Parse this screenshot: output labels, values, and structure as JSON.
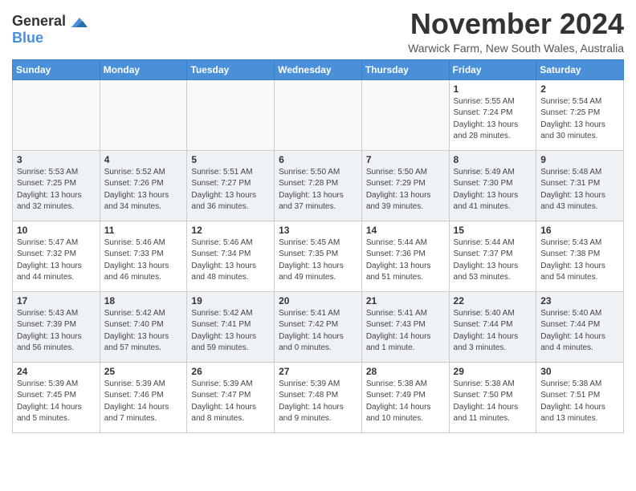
{
  "header": {
    "logo_general": "General",
    "logo_blue": "Blue",
    "month_title": "November 2024",
    "subtitle": "Warwick Farm, New South Wales, Australia"
  },
  "weekdays": [
    "Sunday",
    "Monday",
    "Tuesday",
    "Wednesday",
    "Thursday",
    "Friday",
    "Saturday"
  ],
  "weeks": [
    [
      {
        "day": "",
        "info": ""
      },
      {
        "day": "",
        "info": ""
      },
      {
        "day": "",
        "info": ""
      },
      {
        "day": "",
        "info": ""
      },
      {
        "day": "",
        "info": ""
      },
      {
        "day": "1",
        "info": "Sunrise: 5:55 AM\nSunset: 7:24 PM\nDaylight: 13 hours\nand 28 minutes."
      },
      {
        "day": "2",
        "info": "Sunrise: 5:54 AM\nSunset: 7:25 PM\nDaylight: 13 hours\nand 30 minutes."
      }
    ],
    [
      {
        "day": "3",
        "info": "Sunrise: 5:53 AM\nSunset: 7:25 PM\nDaylight: 13 hours\nand 32 minutes."
      },
      {
        "day": "4",
        "info": "Sunrise: 5:52 AM\nSunset: 7:26 PM\nDaylight: 13 hours\nand 34 minutes."
      },
      {
        "day": "5",
        "info": "Sunrise: 5:51 AM\nSunset: 7:27 PM\nDaylight: 13 hours\nand 36 minutes."
      },
      {
        "day": "6",
        "info": "Sunrise: 5:50 AM\nSunset: 7:28 PM\nDaylight: 13 hours\nand 37 minutes."
      },
      {
        "day": "7",
        "info": "Sunrise: 5:50 AM\nSunset: 7:29 PM\nDaylight: 13 hours\nand 39 minutes."
      },
      {
        "day": "8",
        "info": "Sunrise: 5:49 AM\nSunset: 7:30 PM\nDaylight: 13 hours\nand 41 minutes."
      },
      {
        "day": "9",
        "info": "Sunrise: 5:48 AM\nSunset: 7:31 PM\nDaylight: 13 hours\nand 43 minutes."
      }
    ],
    [
      {
        "day": "10",
        "info": "Sunrise: 5:47 AM\nSunset: 7:32 PM\nDaylight: 13 hours\nand 44 minutes."
      },
      {
        "day": "11",
        "info": "Sunrise: 5:46 AM\nSunset: 7:33 PM\nDaylight: 13 hours\nand 46 minutes."
      },
      {
        "day": "12",
        "info": "Sunrise: 5:46 AM\nSunset: 7:34 PM\nDaylight: 13 hours\nand 48 minutes."
      },
      {
        "day": "13",
        "info": "Sunrise: 5:45 AM\nSunset: 7:35 PM\nDaylight: 13 hours\nand 49 minutes."
      },
      {
        "day": "14",
        "info": "Sunrise: 5:44 AM\nSunset: 7:36 PM\nDaylight: 13 hours\nand 51 minutes."
      },
      {
        "day": "15",
        "info": "Sunrise: 5:44 AM\nSunset: 7:37 PM\nDaylight: 13 hours\nand 53 minutes."
      },
      {
        "day": "16",
        "info": "Sunrise: 5:43 AM\nSunset: 7:38 PM\nDaylight: 13 hours\nand 54 minutes."
      }
    ],
    [
      {
        "day": "17",
        "info": "Sunrise: 5:43 AM\nSunset: 7:39 PM\nDaylight: 13 hours\nand 56 minutes."
      },
      {
        "day": "18",
        "info": "Sunrise: 5:42 AM\nSunset: 7:40 PM\nDaylight: 13 hours\nand 57 minutes."
      },
      {
        "day": "19",
        "info": "Sunrise: 5:42 AM\nSunset: 7:41 PM\nDaylight: 13 hours\nand 59 minutes."
      },
      {
        "day": "20",
        "info": "Sunrise: 5:41 AM\nSunset: 7:42 PM\nDaylight: 14 hours\nand 0 minutes."
      },
      {
        "day": "21",
        "info": "Sunrise: 5:41 AM\nSunset: 7:43 PM\nDaylight: 14 hours\nand 1 minute."
      },
      {
        "day": "22",
        "info": "Sunrise: 5:40 AM\nSunset: 7:44 PM\nDaylight: 14 hours\nand 3 minutes."
      },
      {
        "day": "23",
        "info": "Sunrise: 5:40 AM\nSunset: 7:44 PM\nDaylight: 14 hours\nand 4 minutes."
      }
    ],
    [
      {
        "day": "24",
        "info": "Sunrise: 5:39 AM\nSunset: 7:45 PM\nDaylight: 14 hours\nand 5 minutes."
      },
      {
        "day": "25",
        "info": "Sunrise: 5:39 AM\nSunset: 7:46 PM\nDaylight: 14 hours\nand 7 minutes."
      },
      {
        "day": "26",
        "info": "Sunrise: 5:39 AM\nSunset: 7:47 PM\nDaylight: 14 hours\nand 8 minutes."
      },
      {
        "day": "27",
        "info": "Sunrise: 5:39 AM\nSunset: 7:48 PM\nDaylight: 14 hours\nand 9 minutes."
      },
      {
        "day": "28",
        "info": "Sunrise: 5:38 AM\nSunset: 7:49 PM\nDaylight: 14 hours\nand 10 minutes."
      },
      {
        "day": "29",
        "info": "Sunrise: 5:38 AM\nSunset: 7:50 PM\nDaylight: 14 hours\nand 11 minutes."
      },
      {
        "day": "30",
        "info": "Sunrise: 5:38 AM\nSunset: 7:51 PM\nDaylight: 14 hours\nand 13 minutes."
      }
    ]
  ]
}
